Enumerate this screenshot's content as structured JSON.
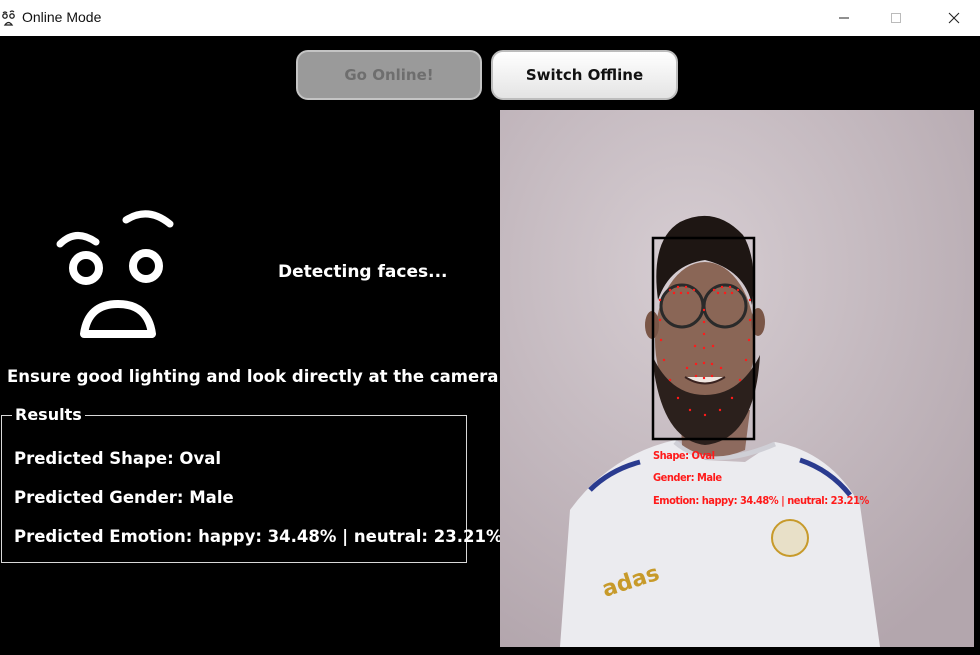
{
  "window": {
    "title": "Online Mode",
    "app_icon": "face-icon",
    "controls": [
      "minimize-icon",
      "maximize-icon",
      "close-icon"
    ]
  },
  "toolbar": {
    "go_online_label": "Go Online!",
    "go_online_state": "disabled",
    "switch_offline_label": "Switch Offline"
  },
  "status": {
    "face_icon": "surprised-face-icon",
    "message": "Detecting faces...",
    "hint": "Ensure good lighting and look directly at the camera."
  },
  "results": {
    "title": "Results",
    "shape": "Predicted Shape: Oval",
    "gender": "Predicted Gender: Male",
    "emotion": "Predicted Emotion: happy: 34.48% | neutral: 23.21%"
  },
  "camera_overlay": {
    "shape": "Shape: Oval",
    "gender": "Gender: Male",
    "emotion": "Emotion: happy: 34.48% | neutral: 23.21%",
    "color": "#ff1a1a"
  },
  "colors": {
    "background": "#000000",
    "titlebar": "#ffffff",
    "landmark": "#ff1a1a"
  }
}
